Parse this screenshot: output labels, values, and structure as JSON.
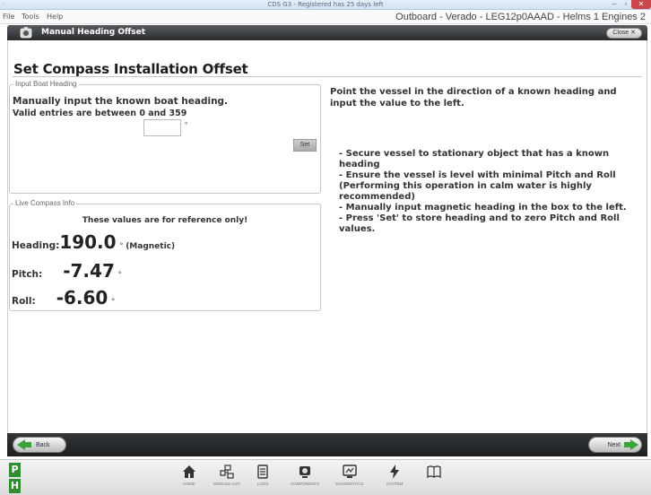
{
  "window": {
    "title": "CDS G3 - Registered has 25 days left",
    "controls": {
      "minimize": "–",
      "maximize": "▫",
      "close": "✕"
    }
  },
  "menubar": {
    "items": [
      "File",
      "Tools",
      "Help"
    ],
    "engine_info": "Outboard - Verado - LEG12p0AAAD - Helms 1 Engines 2"
  },
  "section": {
    "title": "Manual Heading Offset",
    "close_label": "Close"
  },
  "page": {
    "heading": "Set Compass Installation Offset"
  },
  "input_group": {
    "legend": "Input Boat Heading",
    "line1": "Manually input the known boat heading.",
    "line2": "Valid entries are between 0 and 359",
    "heading_value": "",
    "degree_symbol": "°",
    "set_label": "Set"
  },
  "compass_group": {
    "legend": "Live Compass Info",
    "note": "These values are for reference only!",
    "heading_label": "Heading:",
    "heading_value": "190.0",
    "heading_unit": "°",
    "heading_ref": "(Magnetic)",
    "pitch_label": "Pitch:",
    "pitch_value": "-7.47",
    "pitch_unit": "°",
    "roll_label": "Roll:",
    "roll_value": "-6.60",
    "roll_unit": "°"
  },
  "instructions": {
    "intro": "Point the vessel in the direction of a known heading and input the value to the left.",
    "steps": [
      "- Secure vessel to stationary object that has a known heading",
      "- Ensure the vessel is level with minimal Pitch and Roll (Performing this operation in calm water is highly recommended)",
      "- Manually input magnetic heading in the box to the left.",
      "- Press 'Set' to store heading and to zero Pitch and Roll values."
    ]
  },
  "navigation": {
    "back_label": "Back",
    "next_label": "Next"
  },
  "taskbar": {
    "p_label": "P",
    "h_label": "H",
    "items": [
      {
        "icon": "home-icon",
        "caption": "HOME"
      },
      {
        "icon": "module-list-icon",
        "caption": "MODULE LIST"
      },
      {
        "icon": "logs-icon",
        "caption": "LOGS"
      },
      {
        "icon": "components-icon",
        "caption": "COMPONENTS"
      },
      {
        "icon": "diagnostics-icon",
        "caption": "DIAGNOSTICS"
      },
      {
        "icon": "lightning-icon",
        "caption": "SYSTEM"
      },
      {
        "icon": "book-icon",
        "caption": ""
      }
    ]
  },
  "colors": {
    "accent_green": "#3aa33a",
    "dark_bar": "#2a2c2f",
    "close_red": "#c9474b"
  }
}
